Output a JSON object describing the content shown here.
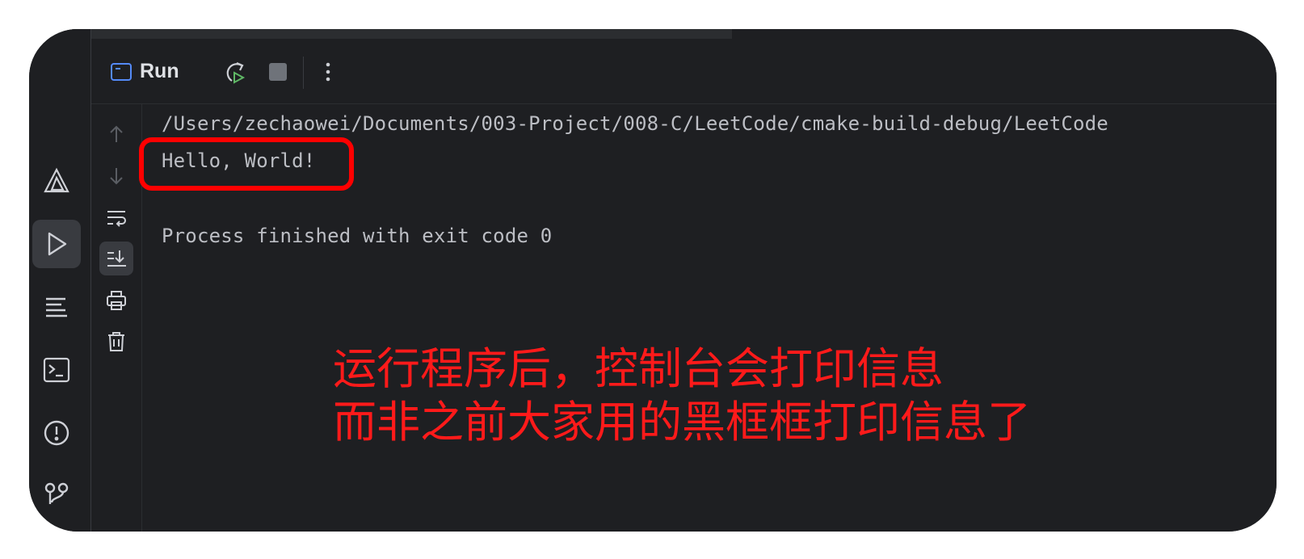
{
  "tool_window": {
    "title": "Run",
    "actions": {
      "rerun_icon": "rerun-icon",
      "stop_icon": "stop-icon",
      "more_icon": "more-vertical-icon"
    }
  },
  "activity_bar": {
    "items": [
      {
        "name": "project-structure-icon",
        "active": false
      },
      {
        "name": "run-icon",
        "active": true
      },
      {
        "name": "structure-icon",
        "active": false
      },
      {
        "name": "terminal-icon",
        "active": false
      },
      {
        "name": "problems-icon",
        "active": false
      },
      {
        "name": "git-icon",
        "active": false
      }
    ]
  },
  "console_toolbar": {
    "items": [
      {
        "name": "scroll-up-icon",
        "active": false
      },
      {
        "name": "scroll-down-icon",
        "active": false
      },
      {
        "name": "soft-wrap-icon",
        "active": false
      },
      {
        "name": "scroll-to-end-icon",
        "active": true
      },
      {
        "name": "print-icon",
        "active": false
      },
      {
        "name": "clear-all-icon",
        "active": false
      }
    ]
  },
  "console": {
    "lines": [
      "/Users/zechaowei/Documents/003-Project/008-C/LeetCode/cmake-build-debug/LeetCode",
      "Hello, World!",
      "",
      "Process finished with exit code 0"
    ]
  },
  "annotation": {
    "line1": "运行程序后，控制台会打印信息",
    "line2": "而非之前大家用的黑框框打印信息了",
    "color": "#ff0000"
  },
  "colors": {
    "background": "#1e1f22",
    "text": "#bcbec4",
    "accent": "#548af7",
    "rerun_green": "#5fb865"
  }
}
